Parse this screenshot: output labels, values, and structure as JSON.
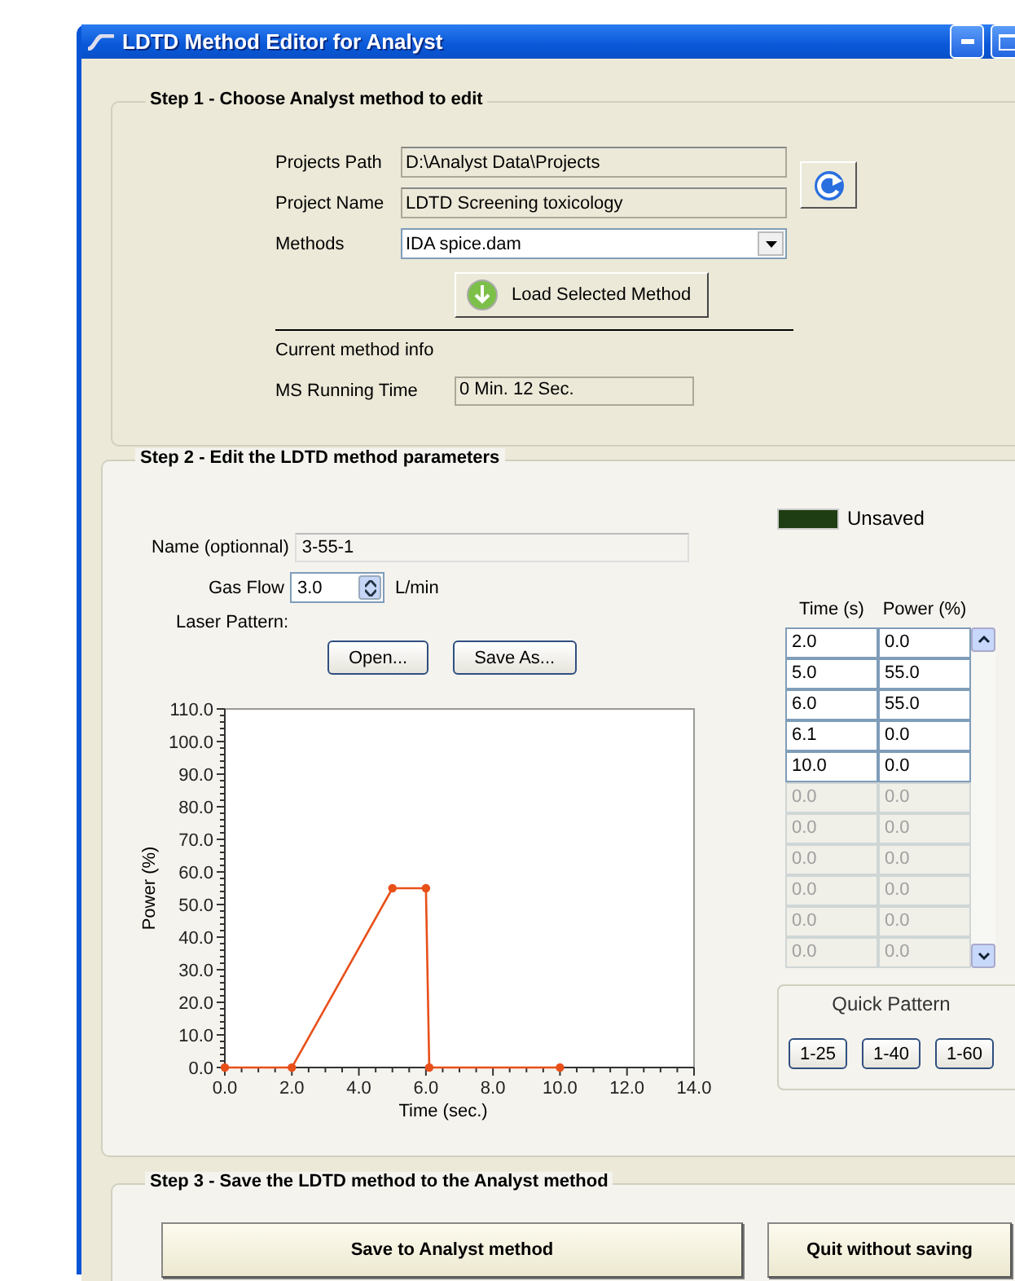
{
  "window": {
    "title": "LDTD Method Editor for Analyst"
  },
  "step1": {
    "legend": "Step 1 - Choose Analyst method to edit",
    "fields": [
      {
        "label": "Projects Path",
        "value": "D:\\Analyst Data\\Projects",
        "kind": "text"
      },
      {
        "label": "Project Name",
        "value": "LDTD Screening toxicology",
        "kind": "text"
      },
      {
        "label": "Methods",
        "value": "IDA spice.dam",
        "kind": "dropdown"
      }
    ],
    "load_button": "Load Selected Method",
    "info_heading": "Current method info",
    "running_time": {
      "label": "MS Running Time",
      "value": "0 Min. 12 Sec."
    }
  },
  "step2": {
    "legend": "Step 2 - Edit the LDTD method parameters",
    "name": {
      "label": "Name (optionnal)",
      "value": "3-55-1"
    },
    "status": {
      "label": "Unsaved",
      "saved": false
    },
    "gas_flow": {
      "label": "Gas Flow",
      "value": "3.0",
      "unit": "L/min"
    },
    "laser_pattern_label": "Laser Pattern:",
    "pattern_buttons": [
      "Open...",
      "Save As..."
    ],
    "chart_data": {
      "type": "line",
      "xlabel": "Time (sec.)",
      "ylabel": "Power (%)",
      "x": [
        0,
        2,
        5,
        6,
        6.1,
        10
      ],
      "series": [
        {
          "color": "#e8501a",
          "marker": "circle",
          "values": [
            0,
            0,
            55,
            55,
            0,
            0
          ]
        }
      ],
      "xlim": [
        0,
        14
      ],
      "ylim": [
        0,
        110
      ],
      "xticks": [
        {
          "value": 0,
          "label": "0.0"
        },
        {
          "value": 2,
          "label": "2.0"
        },
        {
          "value": 4,
          "label": "4.0"
        },
        {
          "value": 6,
          "label": "6.0"
        },
        {
          "value": 8,
          "label": "8.0"
        },
        {
          "value": 10,
          "label": "10.0"
        },
        {
          "value": 12,
          "label": "12.0"
        },
        {
          "value": 14,
          "label": "14.0"
        }
      ],
      "yticks": [
        {
          "value": 0,
          "label": "0.0"
        },
        {
          "value": 10,
          "label": "10.0"
        },
        {
          "value": 20,
          "label": "20.0"
        },
        {
          "value": 30,
          "label": "30.0"
        },
        {
          "value": 40,
          "label": "40.0"
        },
        {
          "value": 50,
          "label": "50.0"
        },
        {
          "value": 60,
          "label": "60.0"
        },
        {
          "value": 70,
          "label": "70.0"
        },
        {
          "value": 80,
          "label": "80.0"
        },
        {
          "value": 90,
          "label": "90.0"
        },
        {
          "value": 100,
          "label": "100.0"
        },
        {
          "value": 110,
          "label": "110.0"
        }
      ]
    },
    "table": {
      "columns": [
        "Time (s)",
        "Power (%)"
      ],
      "rows": [
        {
          "cells": [
            "2.0",
            "0.0"
          ],
          "disabled": false
        },
        {
          "cells": [
            "5.0",
            "55.0"
          ],
          "disabled": false
        },
        {
          "cells": [
            "6.0",
            "55.0"
          ],
          "disabled": false
        },
        {
          "cells": [
            "6.1",
            "0.0"
          ],
          "disabled": false
        },
        {
          "cells": [
            "10.0",
            "0.0"
          ],
          "disabled": false
        },
        {
          "cells": [
            "0.0",
            "0.0"
          ],
          "disabled": true
        },
        {
          "cells": [
            "0.0",
            "0.0"
          ],
          "disabled": true
        },
        {
          "cells": [
            "0.0",
            "0.0"
          ],
          "disabled": true
        },
        {
          "cells": [
            "0.0",
            "0.0"
          ],
          "disabled": true
        },
        {
          "cells": [
            "0.0",
            "0.0"
          ],
          "disabled": true
        },
        {
          "cells": [
            "0.0",
            "0.0"
          ],
          "disabled": true
        }
      ]
    },
    "quick_pattern": {
      "title": "Quick Pattern",
      "buttons": [
        "1-25",
        "1-40",
        "1-60"
      ]
    }
  },
  "step3": {
    "legend": "Step 3 - Save the LDTD method to the Analyst method",
    "buttons": [
      "Save to Analyst method",
      "Quit without saving"
    ]
  }
}
